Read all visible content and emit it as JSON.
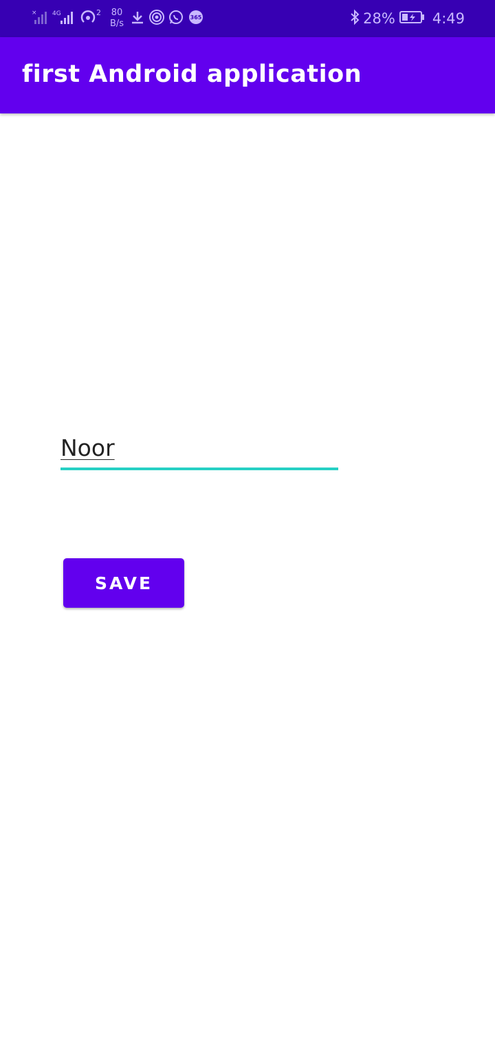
{
  "status_bar": {
    "net_speed_value": "80",
    "net_speed_unit": "B/s",
    "hotspot_count": "2",
    "battery_percent": "28%",
    "time": "4:49",
    "icons": [
      "signal-no-sim-icon",
      "signal-4g-icon",
      "hotspot-icon",
      "download-icon",
      "wireless-icon",
      "whatsapp-icon",
      "app-365-icon",
      "bluetooth-icon",
      "battery-charging-icon"
    ]
  },
  "app_bar": {
    "title": "first Android application",
    "color": "#6200ee"
  },
  "form": {
    "name_field_value": "Noor",
    "underline_color": "#26d0c4",
    "save_label": "SAVE"
  },
  "colors": {
    "status_bar": "#3700b3",
    "primary": "#6200ee",
    "accent": "#26d0c4"
  }
}
